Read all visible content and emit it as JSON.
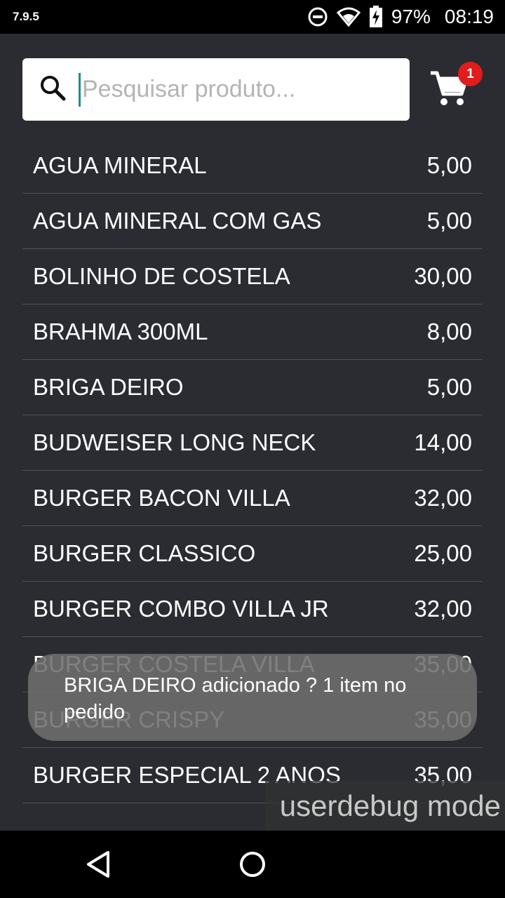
{
  "status_bar": {
    "version": "7.9.5",
    "battery_percent": "97%",
    "time": "08:19",
    "icons": [
      "do-not-disturb-icon",
      "wifi-icon",
      "battery-charging-icon"
    ]
  },
  "search": {
    "placeholder": "Pesquisar produto...",
    "value": ""
  },
  "cart": {
    "badge_count": "1",
    "badge_color": "#e21b1b"
  },
  "products": [
    {
      "name": "AGUA MINERAL",
      "price": "5,00"
    },
    {
      "name": "AGUA MINERAL COM GAS",
      "price": "5,00"
    },
    {
      "name": "BOLINHO DE COSTELA",
      "price": "30,00"
    },
    {
      "name": "BRAHMA 300ML",
      "price": "8,00"
    },
    {
      "name": "BRIGA DEIRO",
      "price": "5,00"
    },
    {
      "name": "BUDWEISER LONG NECK",
      "price": "14,00"
    },
    {
      "name": "BURGER BACON VILLA",
      "price": "32,00"
    },
    {
      "name": "BURGER CLASSICO",
      "price": "25,00"
    },
    {
      "name": "BURGER COMBO VILLA JR",
      "price": "32,00"
    },
    {
      "name": "BURGER COSTELA VILLA",
      "price": "35,00"
    },
    {
      "name": "BURGER CRISPY",
      "price": "35,00"
    },
    {
      "name": "BURGER ESPECIAL 2 ANOS",
      "price": "35,00"
    }
  ],
  "toast": {
    "message": "BRIGA DEIRO adicionado ? 1 item no pedido"
  },
  "debug_overlay": {
    "text": "userdebug mode"
  },
  "colors": {
    "background": "#2a2c31",
    "accent_caret": "#1a8f86",
    "divider": "#4f5258"
  }
}
